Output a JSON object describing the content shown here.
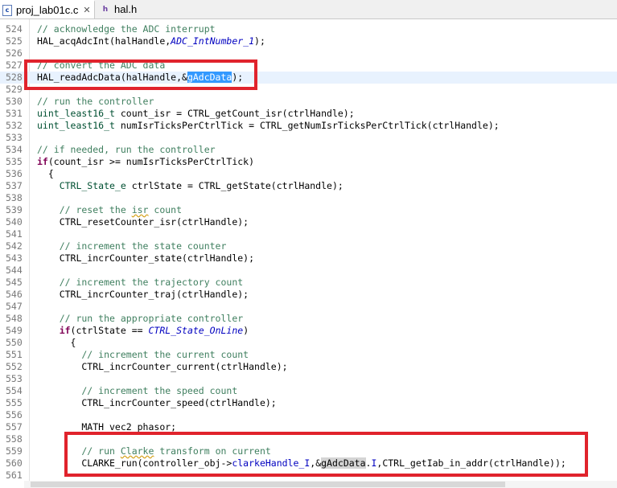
{
  "tabs": [
    {
      "label": "proj_lab01c.c",
      "icon": "c-file-icon",
      "active": true
    },
    {
      "label": "hal.h",
      "icon": "h-file-icon",
      "active": false
    }
  ],
  "lines": [
    {
      "n": "524",
      "parts": [
        [
          "cm",
          "// acknowledge the ADC interrupt"
        ]
      ]
    },
    {
      "n": "525",
      "parts": [
        [
          "fn",
          "HAL_acqAdcInt(halHandle,"
        ],
        [
          "it",
          "ADC_IntNumber_1"
        ],
        [
          "fn",
          ");"
        ]
      ]
    },
    {
      "n": "526",
      "parts": []
    },
    {
      "n": "527",
      "parts": [
        [
          "cm",
          "// convert the ADC data"
        ]
      ]
    },
    {
      "n": "528",
      "parts": [
        [
          "fn",
          "HAL_readAdcData(halHandle,&"
        ],
        [
          "sel",
          "gAdcData"
        ],
        [
          "fn",
          ");"
        ]
      ],
      "current": true
    },
    {
      "n": "529",
      "parts": []
    },
    {
      "n": "530",
      "parts": [
        [
          "cm",
          "// run the controller"
        ]
      ]
    },
    {
      "n": "531",
      "parts": [
        [
          "ty",
          "uint_least16_t"
        ],
        [
          "fn",
          " count_isr = CTRL_getCount_isr(ctrlHandle);"
        ]
      ]
    },
    {
      "n": "532",
      "parts": [
        [
          "ty",
          "uint_least16_t"
        ],
        [
          "fn",
          " numIsrTicksPerCtrlTick = CTRL_getNumIsrTicksPerCtrlTick(ctrlHandle);"
        ]
      ]
    },
    {
      "n": "533",
      "parts": []
    },
    {
      "n": "534",
      "parts": [
        [
          "cm",
          "// if needed, run the controller"
        ]
      ]
    },
    {
      "n": "535",
      "parts": [
        [
          "kw",
          "if"
        ],
        [
          "fn",
          "(count_isr >= numIsrTicksPerCtrlTick)"
        ]
      ]
    },
    {
      "n": "536",
      "parts": [
        [
          "fn",
          "  {"
        ]
      ]
    },
    {
      "n": "537",
      "parts": [
        [
          "ty",
          "    CTRL_State_e"
        ],
        [
          "fn",
          " ctrlState = CTRL_getState(ctrlHandle);"
        ]
      ]
    },
    {
      "n": "538",
      "parts": []
    },
    {
      "n": "539",
      "parts": [
        [
          "cm",
          "    // reset the "
        ],
        [
          "cmsq",
          "isr"
        ],
        [
          "cm",
          " count"
        ]
      ]
    },
    {
      "n": "540",
      "parts": [
        [
          "fn",
          "    CTRL_resetCounter_isr(ctrlHandle);"
        ]
      ]
    },
    {
      "n": "541",
      "parts": []
    },
    {
      "n": "542",
      "parts": [
        [
          "cm",
          "    // increment the state counter"
        ]
      ]
    },
    {
      "n": "543",
      "parts": [
        [
          "fn",
          "    CTRL_incrCounter_state(ctrlHandle);"
        ]
      ]
    },
    {
      "n": "544",
      "parts": []
    },
    {
      "n": "545",
      "parts": [
        [
          "cm",
          "    // increment the trajectory count"
        ]
      ]
    },
    {
      "n": "546",
      "parts": [
        [
          "fn",
          "    CTRL_incrCounter_traj(ctrlHandle);"
        ]
      ]
    },
    {
      "n": "547",
      "parts": []
    },
    {
      "n": "548",
      "parts": [
        [
          "cm",
          "    // run the appropriate controller"
        ]
      ]
    },
    {
      "n": "549",
      "parts": [
        [
          "kw",
          "    if"
        ],
        [
          "fn",
          "(ctrlState == "
        ],
        [
          "it",
          "CTRL_State_OnLine"
        ],
        [
          "fn",
          ")"
        ]
      ]
    },
    {
      "n": "550",
      "parts": [
        [
          "fn",
          "      {"
        ]
      ]
    },
    {
      "n": "551",
      "parts": [
        [
          "cm",
          "        // increment the current count"
        ]
      ]
    },
    {
      "n": "552",
      "parts": [
        [
          "fn",
          "        CTRL_incrCounter_current(ctrlHandle);"
        ]
      ]
    },
    {
      "n": "553",
      "parts": []
    },
    {
      "n": "554",
      "parts": [
        [
          "cm",
          "        // increment the speed count"
        ]
      ]
    },
    {
      "n": "555",
      "parts": [
        [
          "fn",
          "        CTRL_incrCounter_speed(ctrlHandle);"
        ]
      ]
    },
    {
      "n": "556",
      "parts": []
    },
    {
      "n": "557",
      "parts": [
        [
          "fn",
          "        MATH_vec2 phasor;"
        ]
      ]
    },
    {
      "n": "558",
      "parts": []
    },
    {
      "n": "559",
      "parts": [
        [
          "cm",
          "        // run "
        ],
        [
          "cmsq",
          "Clarke"
        ],
        [
          "cm",
          " transform on current"
        ]
      ]
    },
    {
      "n": "560",
      "parts": [
        [
          "fn",
          "        CLARKE_run(controller_obj->"
        ],
        [
          "mbr",
          "clarkeHandle_I"
        ],
        [
          "fn",
          ",&"
        ],
        [
          "occ",
          "gAdcData"
        ],
        [
          "fn",
          "."
        ],
        [
          "mbr",
          "I"
        ],
        [
          "fn",
          ",CTRL_getIab_in_addr(ctrlHandle));"
        ]
      ]
    },
    {
      "n": "561",
      "parts": []
    }
  ]
}
